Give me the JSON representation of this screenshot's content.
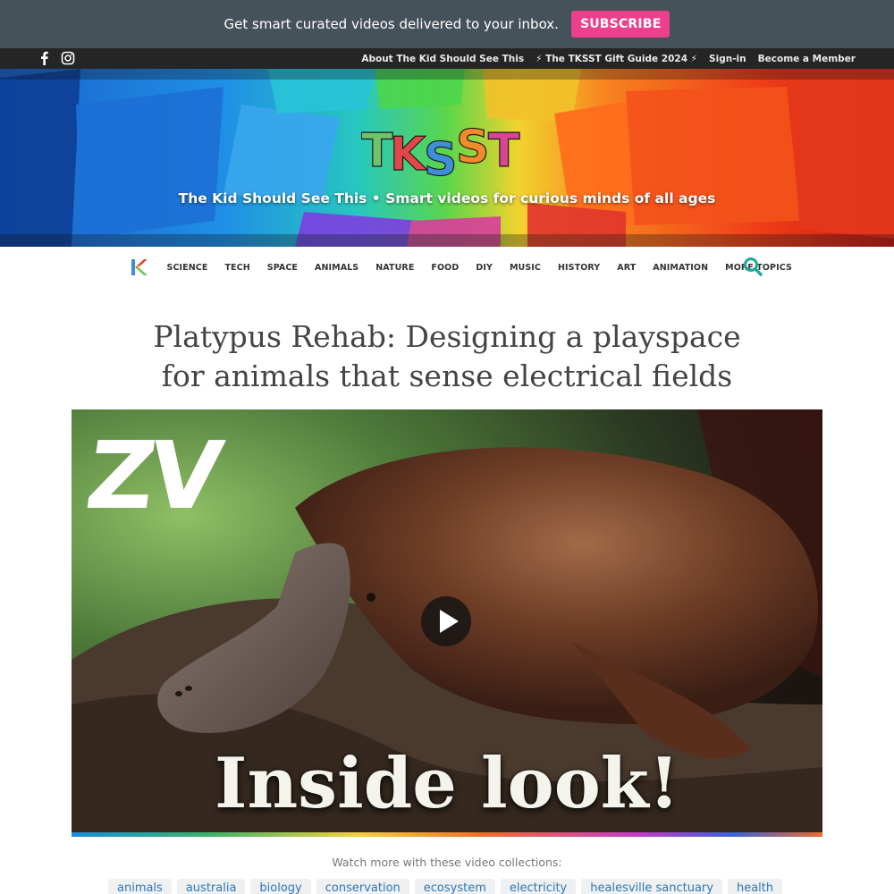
{
  "promo": {
    "text": "Get smart curated videos delivered to your inbox.",
    "button": "SUBSCRIBE"
  },
  "topbar": {
    "social": [
      "facebook-icon",
      "instagram-icon"
    ],
    "links": [
      "About The Kid Should See This",
      "⚡ The TKSST Gift Guide 2024 ⚡",
      "Sign-in",
      "Become a Member"
    ]
  },
  "hero": {
    "logo_text": "TKSST",
    "tagline": "The Kid Should See This • Smart videos for curious minds of all ages"
  },
  "nav": {
    "items": [
      "SCIENCE",
      "TECH",
      "SPACE",
      "ANIMALS",
      "NATURE",
      "FOOD",
      "DIY",
      "MUSIC",
      "HISTORY",
      "ART",
      "ANIMATION",
      "MORE TOPICS"
    ]
  },
  "article": {
    "title_line1": "Platypus Rehab: Designing a playspace",
    "title_line2": "for animals that sense electrical fields"
  },
  "video": {
    "thumb_logo": "ZV",
    "thumb_caption": "Inside look!"
  },
  "collections": {
    "label": "Watch more with these video collections:",
    "tags": [
      "animals",
      "australia",
      "biology",
      "conservation",
      "ecosystem",
      "electricity",
      "healesville sanctuary",
      "health"
    ]
  },
  "colors": {
    "promo_bg": "#46525a",
    "subscribe": "#ec3f8c",
    "link": "#2f77b5",
    "search": "#1ea898"
  }
}
